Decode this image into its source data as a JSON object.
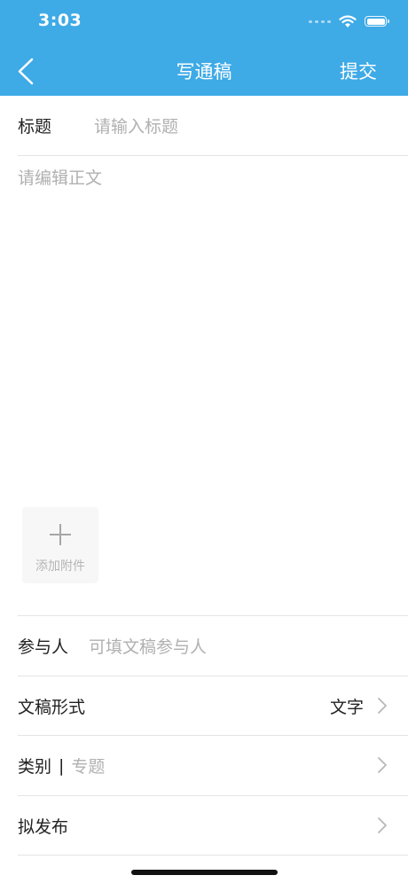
{
  "status_bar": {
    "time": "3:03"
  },
  "nav": {
    "title": "写通稿",
    "submit_label": "提交"
  },
  "form": {
    "title_label": "标题",
    "title_placeholder": "请输入标题",
    "body_placeholder": "请编辑正文",
    "attachment_label": "添加附件",
    "participants_label": "参与人",
    "participants_placeholder": "可填文稿参与人",
    "format_label": "文稿形式",
    "format_value": "文字",
    "category_label": "类别",
    "category_separator": "|",
    "category_value": "专题",
    "publish_label": "拟发布"
  },
  "colors": {
    "header_bg": "#3eaae6",
    "placeholder": "#b0b0b0",
    "divider": "#e4e4e4"
  },
  "icons": [
    "signal-icon",
    "wifi-icon",
    "battery-icon",
    "back-arrow-icon",
    "plus-icon",
    "chevron-right-icon"
  ]
}
